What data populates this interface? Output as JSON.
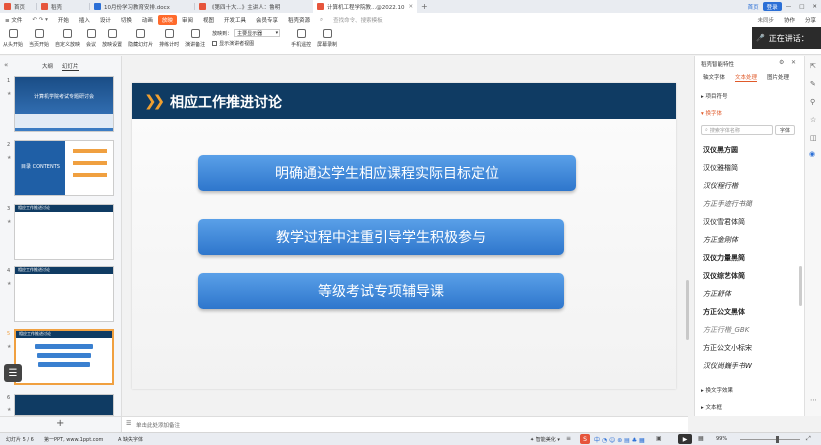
{
  "titlebar": {
    "tabs": [
      {
        "label": "首页",
        "color": "#e6553c"
      },
      {
        "label": "稻壳",
        "color": "#e6553c"
      },
      {
        "label": "10月份学习教育安排.docx",
        "color": "#2b6fd6"
      },
      {
        "label": "《第四十大...》主讲人：鲁明",
        "color": "#e6553c"
      },
      {
        "label": "计算机工程学院教...@2022.10",
        "color": "#e6553c"
      }
    ],
    "right_items": [
      "首页",
      "登录",
      "—",
      "□",
      "✕"
    ]
  },
  "menubar": {
    "items": [
      "≡ 文件",
      "开始",
      "插入",
      "设计",
      "切换",
      "动画",
      "放映",
      "审阅",
      "视图",
      "开发工具",
      "会员专享",
      "稻壳资源"
    ],
    "active": "放映",
    "search_placeholder": "查找命令、搜索模板",
    "right_items": [
      "未同步",
      "协作",
      "分享"
    ]
  },
  "ribbon": {
    "buttons": [
      "从头开始",
      "当页开始",
      "自定义放映",
      "会议",
      "放映设置",
      "隐藏幻灯片",
      "排练计时",
      "演讲备注"
    ],
    "screen_label": "放映到：",
    "screen_value": "主要显示器",
    "presenter_label": "显示演讲者视图",
    "right_buttons": [
      "手机遥控",
      "屏幕录制"
    ]
  },
  "overlay": {
    "speaking_text": "正在讲话："
  },
  "leftpanel": {
    "tabs": [
      "大纲",
      "幻灯片"
    ],
    "thumbs": [
      {
        "num": "1",
        "title": "计算机学院考试专题研讨会"
      },
      {
        "num": "2",
        "title": "目录 CONTENTS"
      },
      {
        "num": "3",
        "title": "相应工作推进讨论"
      },
      {
        "num": "4",
        "title": "相应工作推进讨论"
      },
      {
        "num": "5",
        "title": "相应工作推进讨论"
      },
      {
        "num": "6",
        "title": ""
      }
    ]
  },
  "slide": {
    "title": "相应工作推进讨论",
    "items": [
      "明确通达学生相应课程实际目标定位",
      "教学过程中注重引导学生积极参与",
      "等级考试专项辅导课"
    ]
  },
  "notes": {
    "placeholder": "单击此处添加备注"
  },
  "rightpanel": {
    "title": "稻壳智能特性",
    "tabs": [
      "轴文字体",
      "文本处理",
      "图片处理"
    ],
    "sections": [
      "项目符号",
      "换字体"
    ],
    "search_placeholder": "搜索字体名称",
    "search_btn": "字体",
    "fonts": [
      "汉仪黑方圆",
      "汉仪雅楷简",
      "汉仪程行楷",
      "方正手迹行书简",
      "汉仪雪君体简",
      "方正金刚体",
      "汉仪力量黑简",
      "汉仪综艺体简",
      "方正舒体",
      "方正公文黑体",
      "方正行楷_GBK",
      "方正公文小标宋",
      "汉仪尚巍手书W"
    ],
    "bottom_sections": [
      "换文字效果",
      "文本框"
    ]
  },
  "statusbar": {
    "slide_info": "幻灯片 5 / 6",
    "template": "第一PPT, www.1ppt.com",
    "font_missing": "缺失字体",
    "beautify": "智能美化",
    "zoom": "99%"
  },
  "colors": {
    "accent": "#ff6a2b",
    "slide_header": "#0f3b63",
    "pill_top": "#5aa0e8",
    "pill_bottom": "#2e76cc",
    "selection": "#f0a040"
  }
}
